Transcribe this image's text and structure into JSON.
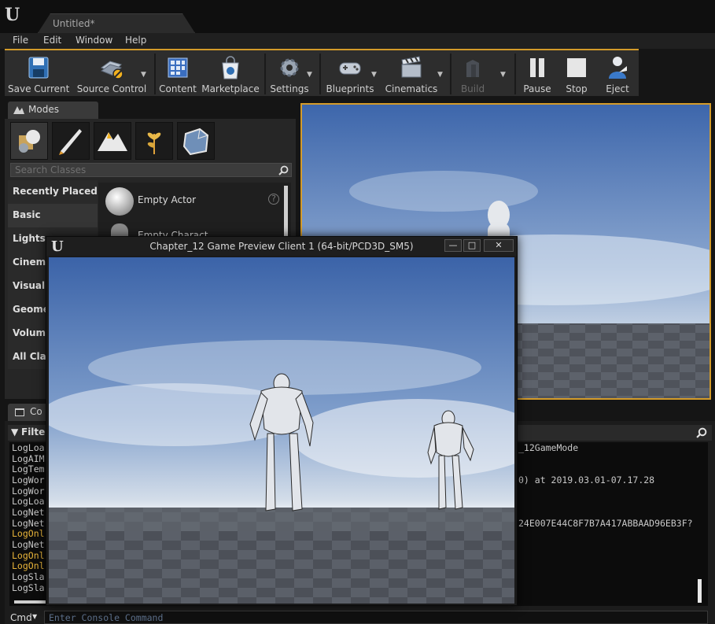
{
  "title_bar": {
    "logo": "U",
    "tab_label": "Untitled*"
  },
  "menu": [
    "File",
    "Edit",
    "Window",
    "Help"
  ],
  "toolbar": [
    {
      "label": "Save Current",
      "icon": "save-icon"
    },
    {
      "label": "Source Control",
      "icon": "source-control-icon"
    },
    {
      "label": "Content",
      "icon": "content-icon"
    },
    {
      "label": "Marketplace",
      "icon": "marketplace-icon"
    },
    {
      "label": "Settings",
      "icon": "settings-icon"
    },
    {
      "label": "Blueprints",
      "icon": "blueprints-icon"
    },
    {
      "label": "Cinematics",
      "icon": "cinematics-icon"
    },
    {
      "label": "Build",
      "icon": "build-icon"
    },
    {
      "label": "Pause",
      "icon": "pause-icon"
    },
    {
      "label": "Stop",
      "icon": "stop-icon"
    },
    {
      "label": "Eject",
      "icon": "eject-icon"
    }
  ],
  "modes": {
    "tab_label": "Modes",
    "search_placeholder": "Search Classes",
    "categories": [
      "Recently Placed",
      "Basic",
      "Lights",
      "Cinema",
      "Visual I",
      "Geome",
      "Volume",
      "All Clas"
    ],
    "actors": [
      "Empty Actor",
      "Empty Charact"
    ]
  },
  "console": {
    "tab_label": "Co",
    "filters_label": "Filters",
    "log_prefixes": [
      "LogLoa",
      "LogAIM",
      "LogTem",
      "LogWor",
      "LogWor",
      "LogLoa",
      "LogNet",
      "LogNet",
      "LogOnl",
      "LogNet",
      "LogOnl",
      "LogOnl",
      "LogSla",
      "LogSla"
    ],
    "log_tails": [
      "_12GameMode",
      "0) at 2019.03.01-07.17.28",
      "24E007E44C8F7B7A417ABBAAD96EB3F?"
    ],
    "cmd_label": "Cmd",
    "cmd_placeholder": "Enter Console Command"
  },
  "game_window": {
    "title": "Chapter_12 Game Preview Client 1 (64-bit/PCD3D_SM5)",
    "min_symbol": "—",
    "max_symbol": "□",
    "close_symbol": "✕"
  },
  "colors": {
    "accent": "#d39b2a",
    "warn_log": "#e8b43a",
    "sky_top": "#3d66ab",
    "ground": "#5a5f68"
  }
}
